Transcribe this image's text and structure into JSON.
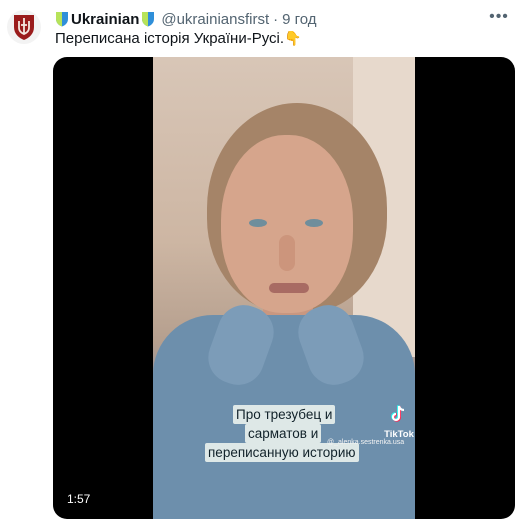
{
  "tweet": {
    "author_name": "Ukrainian",
    "handle": "@ukrainiansfirst",
    "separator": "·",
    "time": "9 год",
    "text": "Переписана історія України-Русі.",
    "emoji": "👇",
    "more_icon": "•••"
  },
  "video": {
    "captions": [
      "Про трезубец и",
      "сарматов и",
      "переписанную историю"
    ],
    "tiktok_label": "TikTok",
    "tiktok_user": "@_alenka.sestrenka.usa",
    "duration": "1:57"
  },
  "colors": {
    "text": "#0f1419",
    "muted": "#536471",
    "badge_green": "#b7e35a",
    "badge_blue": "#2f8fd9"
  }
}
